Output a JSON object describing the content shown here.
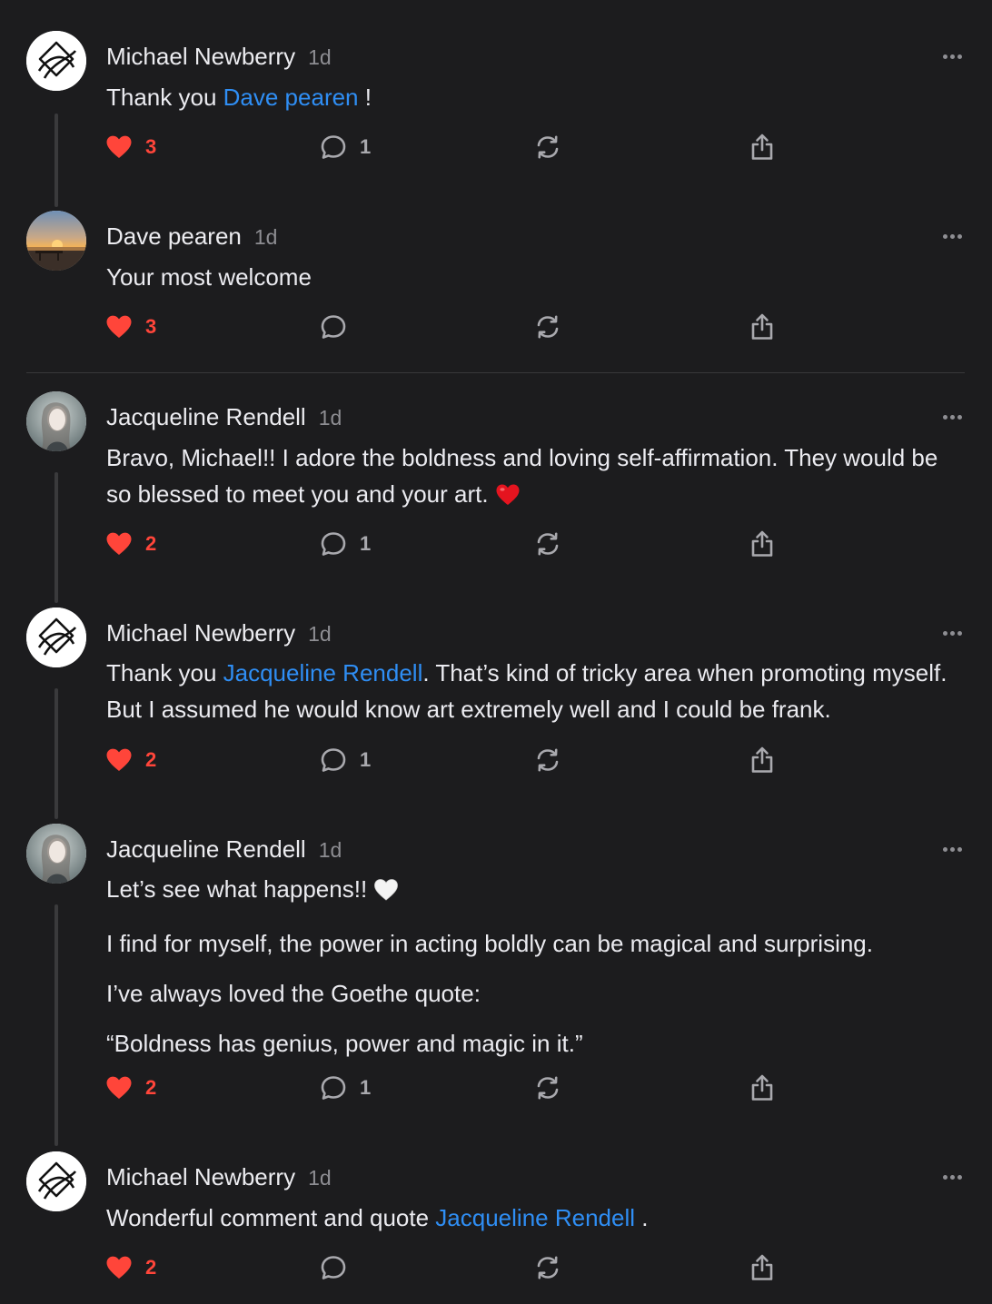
{
  "colors": {
    "background": "#1c1c1e",
    "text": "#ebebf0",
    "muted": "#8e8e93",
    "mention": "#2f8ef4",
    "like": "#ff453a",
    "thread_line": "#3a3a3c"
  },
  "comments": [
    {
      "author": "Michael Newberry",
      "time": "1d",
      "avatar": "logo-avatar",
      "body": [
        [
          {
            "t": "Thank you "
          },
          {
            "t": "Dave pearen",
            "mention": true
          },
          {
            "t": " !"
          }
        ]
      ],
      "likes": "3",
      "replies": "1"
    },
    {
      "author": "Dave pearen",
      "time": "1d",
      "avatar": "sunset-photo-avatar",
      "body": [
        [
          {
            "t": "Your most welcome"
          }
        ]
      ],
      "likes": "3",
      "replies": ""
    },
    {
      "author": "Jacqueline Rendell",
      "time": "1d",
      "avatar": "portrait-photo-avatar",
      "body": [
        [
          {
            "t": "Bravo, Michael!! I adore the boldness and loving self-affirmation. They would be so blessed to meet you and your art. "
          },
          {
            "icon": "red-heart-emoji"
          }
        ]
      ],
      "likes": "2",
      "replies": "1"
    },
    {
      "author": "Michael Newberry",
      "time": "1d",
      "avatar": "logo-avatar",
      "body": [
        [
          {
            "t": "Thank you "
          },
          {
            "t": "Jacqueline Rendell",
            "mention": true
          },
          {
            "t": ". That’s kind of tricky area when promoting myself. But I assumed he would know art extremely well and I could be frank."
          }
        ]
      ],
      "likes": "2",
      "replies": "1"
    },
    {
      "author": "Jacqueline Rendell",
      "time": "1d",
      "avatar": "portrait-photo-avatar",
      "body": [
        [
          {
            "t": "Let’s see what happens!! "
          },
          {
            "icon": "white-heart-emoji"
          }
        ],
        [
          {
            "t": "I find for myself, the power in acting boldly can be magical and surprising."
          }
        ],
        [
          {
            "t": "I’ve always loved the Goethe quote:"
          }
        ],
        [
          {
            "t": "“Boldness has genius, power and magic in it.”"
          }
        ]
      ],
      "likes": "2",
      "replies": "1"
    },
    {
      "author": "Michael Newberry",
      "time": "1d",
      "avatar": "logo-avatar",
      "body": [
        [
          {
            "t": "Wonderful comment and quote "
          },
          {
            "t": "Jacqueline Rendell",
            "mention": true
          },
          {
            "t": " ."
          }
        ]
      ],
      "likes": "2",
      "replies": ""
    }
  ]
}
